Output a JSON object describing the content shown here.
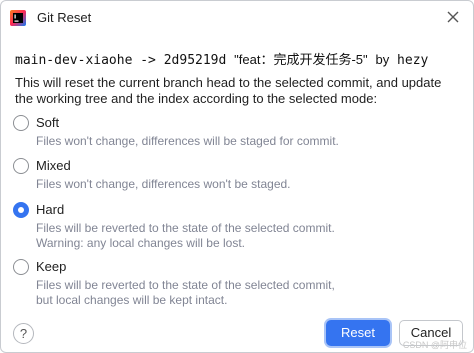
{
  "window": {
    "title": "Git Reset",
    "close_icon": "close-icon",
    "app_icon": "intellij-idea-icon"
  },
  "commit": {
    "branch": "main-dev-xiaohe",
    "arrow": "->",
    "hash": "2d95219d",
    "message": "\"feat：完成开发任务-5\"",
    "author_prefix": "by",
    "author": "hezy"
  },
  "description": "This will reset the current branch head to the selected commit, and update the working tree and the index according to the selected mode:",
  "options": [
    {
      "label": "Soft",
      "help": [
        "Files won't change, differences will be staged for commit."
      ],
      "selected": false
    },
    {
      "label": "Mixed",
      "help": [
        "Files won't change, differences won't be staged."
      ],
      "selected": false
    },
    {
      "label": "Hard",
      "help": [
        "Files will be reverted to the state of the selected commit.",
        "Warning: any local changes will be lost."
      ],
      "selected": true
    },
    {
      "label": "Keep",
      "help": [
        "Files will be reverted to the state of the selected commit,",
        "but local changes will be kept intact."
      ],
      "selected": false
    }
  ],
  "buttons": {
    "help": "?",
    "reset": "Reset",
    "cancel": "Cancel"
  },
  "watermark": "CSDN @阿申位",
  "colors": {
    "accent": "#3574f0",
    "help_text": "#818594"
  }
}
